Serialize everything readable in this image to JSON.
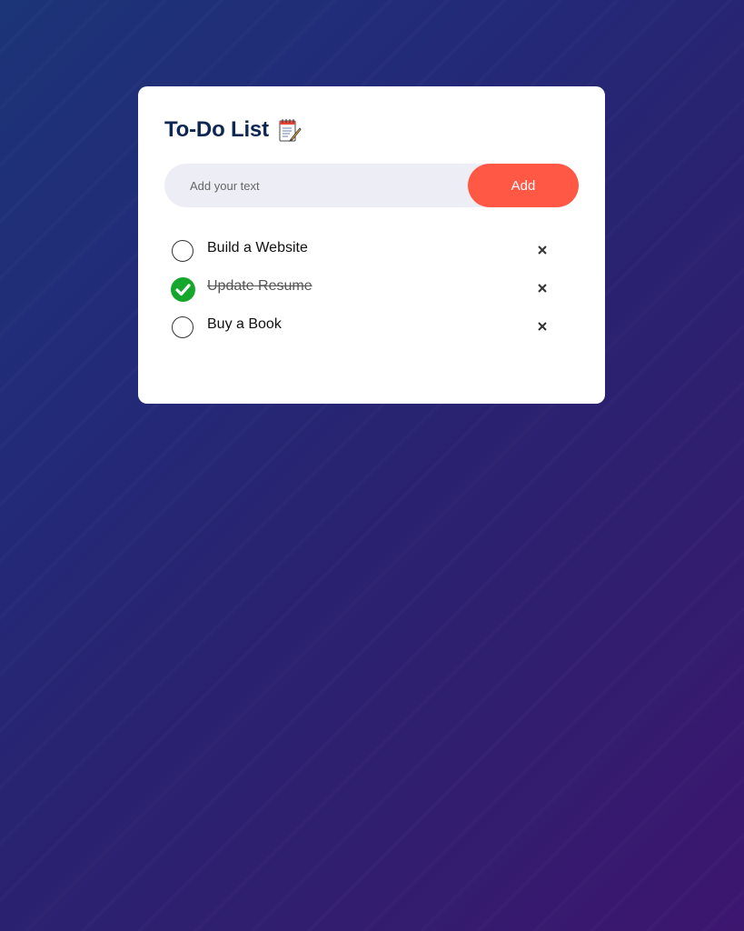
{
  "app": {
    "title": "To-Do List",
    "title_icon": "notepad-icon"
  },
  "input": {
    "placeholder": "Add your text",
    "value": ""
  },
  "add_button": {
    "label": "Add"
  },
  "colors": {
    "title": "#0d2752",
    "add_button": "#ff5945",
    "input_bg": "#edeef5",
    "checked": "#14a72c"
  },
  "tasks": [
    {
      "label": "Build a Website",
      "done": false
    },
    {
      "label": "Update Resume",
      "done": true
    },
    {
      "label": "Buy a Book",
      "done": false
    }
  ],
  "icons": {
    "delete": "close-icon",
    "checked": "check-circle-icon",
    "unchecked": "empty-circle-icon"
  }
}
